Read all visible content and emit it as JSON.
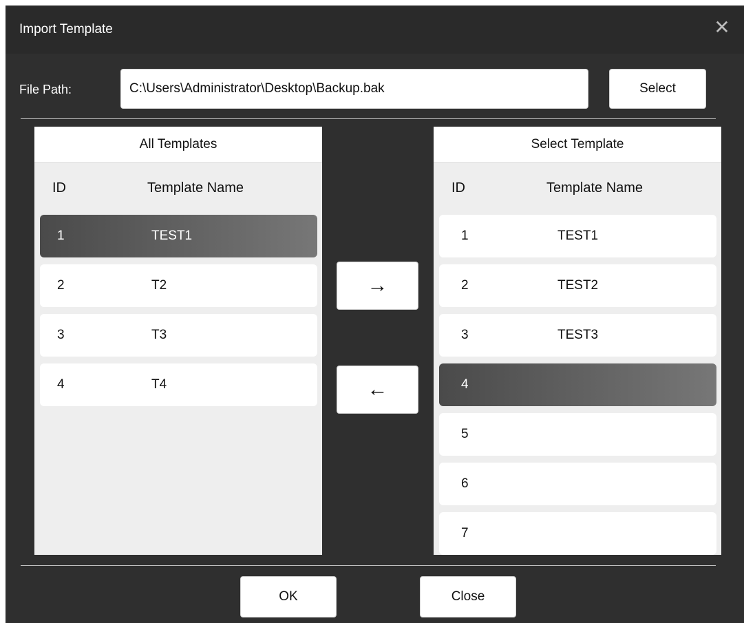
{
  "window": {
    "title": "Import Template",
    "close_icon": "close-icon"
  },
  "file": {
    "label": "File Path:",
    "value": "C:\\Users\\Administrator\\Desktop\\Backup.bak",
    "select_label": "Select"
  },
  "left_panel": {
    "title": "All Templates",
    "col_id": "ID",
    "col_name": "Template Name",
    "rows": [
      {
        "id": "1",
        "name": "TEST1",
        "selected": true
      },
      {
        "id": "2",
        "name": "T2",
        "selected": false
      },
      {
        "id": "3",
        "name": "T3",
        "selected": false
      },
      {
        "id": "4",
        "name": "T4",
        "selected": false
      }
    ]
  },
  "right_panel": {
    "title": "Select Template",
    "col_id": "ID",
    "col_name": "Template Name",
    "rows": [
      {
        "id": "1",
        "name": "TEST1",
        "selected": false
      },
      {
        "id": "2",
        "name": "TEST2",
        "selected": false
      },
      {
        "id": "3",
        "name": "TEST3",
        "selected": false
      },
      {
        "id": "4",
        "name": "",
        "selected": true
      },
      {
        "id": "5",
        "name": "",
        "selected": false
      },
      {
        "id": "6",
        "name": "",
        "selected": false
      },
      {
        "id": "7",
        "name": "",
        "selected": false
      }
    ]
  },
  "transfer": {
    "add_glyph": "→",
    "remove_glyph": "←"
  },
  "footer": {
    "ok_label": "OK",
    "close_label": "Close"
  },
  "colors": {
    "dialog_bg": "#2f2f2f",
    "selected_row": "#5a5a5a",
    "panel_bg": "#eeeeee"
  }
}
